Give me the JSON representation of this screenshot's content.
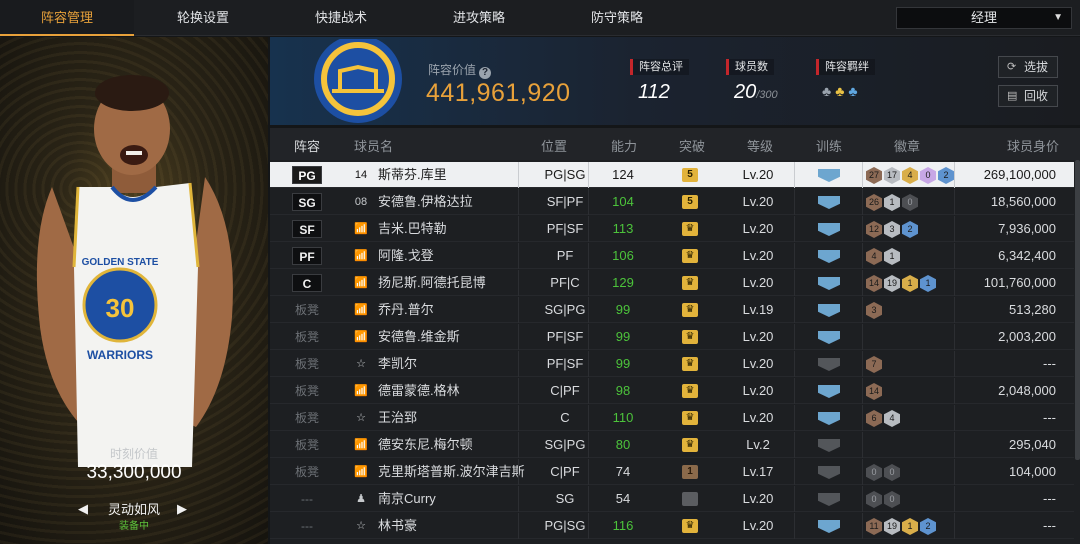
{
  "nav": {
    "tabs": [
      "阵容管理",
      "轮换设置",
      "快捷战术",
      "进攻策略",
      "防守策略"
    ],
    "manager_label": "经理"
  },
  "card": {
    "jersey_team": "GOLDEN STATE",
    "jersey_number": "30",
    "jersey_name": "WARRIORS",
    "moment_label": "时刻价值",
    "moment_value": "33,300,000",
    "card_name": "灵动如风",
    "equipped": "装备中"
  },
  "summary": {
    "lineup_value_label": "阵容价值",
    "lineup_value": "441,961,920",
    "rating_label": "阵容总评",
    "rating_value": "112",
    "count_label": "球员数",
    "count_value": "20",
    "count_max": "/300",
    "bond_label": "阵容羁绊",
    "buttons": [
      "选拔",
      "回收"
    ]
  },
  "table": {
    "headers": [
      "阵容",
      "球员名",
      "位置",
      "能力",
      "突破",
      "等级",
      "训练",
      "徽章",
      "球员身价"
    ],
    "rows": [
      {
        "slot": "PG",
        "num": "14",
        "name": "斯蒂芬.库里",
        "pos": "PG|SG",
        "ability": "124",
        "green": false,
        "breach": "5",
        "breach_type": "gold",
        "level": "Lv.20",
        "train": true,
        "badges": [
          [
            "27",
            "bronze"
          ],
          [
            "17",
            "silver"
          ],
          [
            "4",
            "gold"
          ],
          [
            "0",
            "purple"
          ],
          [
            "2",
            "blue"
          ]
        ],
        "value": "269,100,000"
      },
      {
        "slot": "SG",
        "num": "08",
        "name": "安德鲁.伊格达拉",
        "pos": "SF|PF",
        "ability": "104",
        "green": true,
        "breach": "5",
        "breach_type": "gold",
        "level": "Lv.20",
        "train": true,
        "badges": [
          [
            "26",
            "bronze"
          ],
          [
            "1",
            "silver"
          ],
          [
            "0",
            "dark"
          ]
        ],
        "value": "18,560,000"
      },
      {
        "slot": "SF",
        "num": "",
        "name": "吉米.巴特勒",
        "pos": "PF|SF",
        "ability": "113",
        "green": true,
        "breach": "♛",
        "breach_type": "gold",
        "level": "Lv.20",
        "train": true,
        "badges": [
          [
            "12",
            "bronze"
          ],
          [
            "3",
            "silver"
          ],
          [
            "2",
            "blue"
          ]
        ],
        "value": "7,936,000"
      },
      {
        "slot": "PF",
        "num": "",
        "name": "阿隆.戈登",
        "pos": "PF",
        "ability": "106",
        "green": true,
        "breach": "♛",
        "breach_type": "gold",
        "level": "Lv.20",
        "train": true,
        "badges": [
          [
            "4",
            "bronze"
          ],
          [
            "1",
            "silver"
          ]
        ],
        "value": "6,342,400"
      },
      {
        "slot": "C",
        "num": "",
        "name": "扬尼斯.阿德托昆博",
        "pos": "PF|C",
        "ability": "129",
        "green": true,
        "breach": "♛",
        "breach_type": "gold",
        "level": "Lv.20",
        "train": true,
        "badges": [
          [
            "14",
            "bronze"
          ],
          [
            "19",
            "silver"
          ],
          [
            "1",
            "gold"
          ],
          [
            "1",
            "blue"
          ]
        ],
        "value": "101,760,000"
      },
      {
        "slot": "板凳",
        "num": "",
        "name": "乔丹.普尔",
        "pos": "SG|PG",
        "ability": "99",
        "green": true,
        "breach": "♛",
        "breach_type": "gold",
        "level": "Lv.19",
        "train": true,
        "badges": [
          [
            "3",
            "bronze"
          ]
        ],
        "value": "513,280"
      },
      {
        "slot": "板凳",
        "num": "",
        "name": "安德鲁.维金斯",
        "pos": "PF|SF",
        "ability": "99",
        "green": true,
        "breach": "♛",
        "breach_type": "gold",
        "level": "Lv.20",
        "train": true,
        "badges": [],
        "value": "2,003,200"
      },
      {
        "slot": "板凳",
        "num": "☆",
        "name": "李凯尔",
        "pos": "PF|SF",
        "ability": "99",
        "green": true,
        "breach": "♛",
        "breach_type": "gold",
        "level": "Lv.20",
        "train": false,
        "badges": [
          [
            "7",
            "bronze"
          ]
        ],
        "value": "---"
      },
      {
        "slot": "板凳",
        "num": "",
        "name": "德雷蒙德.格林",
        "pos": "C|PF",
        "ability": "98",
        "green": true,
        "breach": "♛",
        "breach_type": "gold",
        "level": "Lv.20",
        "train": true,
        "badges": [
          [
            "14",
            "bronze"
          ]
        ],
        "value": "2,048,000"
      },
      {
        "slot": "板凳",
        "num": "☆",
        "name": "王治郅",
        "pos": "C",
        "ability": "110",
        "green": true,
        "breach": "♛",
        "breach_type": "gold",
        "level": "Lv.20",
        "train": true,
        "badges": [
          [
            "6",
            "bronze"
          ],
          [
            "4",
            "silver"
          ]
        ],
        "value": "---"
      },
      {
        "slot": "板凳",
        "num": "",
        "name": "德安东尼.梅尔顿",
        "pos": "SG|PG",
        "ability": "80",
        "green": true,
        "breach": "♛",
        "breach_type": "gold",
        "level": "Lv.2",
        "train": false,
        "badges": [],
        "value": "295,040"
      },
      {
        "slot": "板凳",
        "num": "",
        "name": "克里斯塔普斯.波尔津吉斯",
        "pos": "C|PF",
        "ability": "74",
        "green": false,
        "breach": "1",
        "breach_type": "brown",
        "level": "Lv.17",
        "train": false,
        "badges": [
          [
            "0",
            "dark"
          ],
          [
            "0",
            "dark"
          ]
        ],
        "value": "104,000"
      },
      {
        "slot": "---",
        "num": "♟",
        "name": "南京Curry",
        "pos": "SG",
        "ability": "54",
        "green": false,
        "breach": "",
        "breach_type": "dim",
        "level": "Lv.20",
        "train": false,
        "badges": [
          [
            "0",
            "dark"
          ],
          [
            "0",
            "dark"
          ]
        ],
        "value": "---"
      },
      {
        "slot": "---",
        "num": "☆",
        "name": "林书豪",
        "pos": "PG|SG",
        "ability": "116",
        "green": true,
        "breach": "♛",
        "breach_type": "gold",
        "level": "Lv.20",
        "train": true,
        "badges": [
          [
            "11",
            "bronze"
          ],
          [
            "19",
            "silver"
          ],
          [
            "1",
            "gold"
          ],
          [
            "2",
            "blue"
          ]
        ],
        "value": "---"
      }
    ]
  }
}
